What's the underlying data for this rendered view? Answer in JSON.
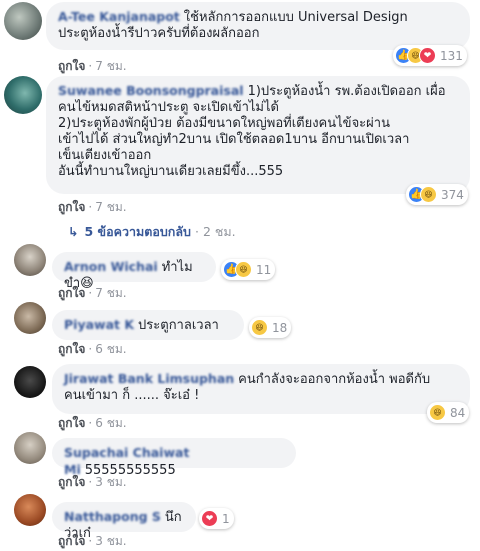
{
  "comments": [
    {
      "author": "A-Tee Kanjanapot",
      "lines": [
        "ใช้หลักการออกแบบ Universal Design",
        "ประตูห้องน้ำรีปาวครับที่ต้องผลักออก"
      ],
      "reactions": [
        "like",
        "haha",
        "love"
      ],
      "reaction_count": "131",
      "like_label": "ถูกใจ",
      "time": "7 ชม."
    },
    {
      "author": "Suwanee Boonsongpraisal",
      "lines": [
        "1)ประตูห้องน้ำ รพ.ต้องเปิดออก เผื่อ",
        "คนไข้หมดสติหน้าประตู จะเปิดเข้าไม่ได้",
        "2)ประตูห้องพักผู้ป่วย ต้องมีขนาดใหญ่พอที่เตียงคนไข้จะผ่าน",
        "เข้าไปได้ ส่วนใหญ่ทำ2บาน เปิดใช้ตลอด1บาน อีกบานเปิดเวลา",
        "เข็นเตียงเข้าออก",
        "อันนี้ทำบานใหญ่บานเดียวเลยมีขึ้ง...555"
      ],
      "reactions": [
        "like",
        "haha"
      ],
      "reaction_count": "374",
      "like_label": "ถูกใจ",
      "time": "7 ชม."
    },
    {
      "author": "Arnon Wichai",
      "lines": [
        "ทำไมขำ😆"
      ],
      "reactions": [
        "like",
        "haha"
      ],
      "reaction_count": "11",
      "like_label": "ถูกใจ",
      "time": "7 ชม."
    },
    {
      "author": "Piyawat K",
      "lines": [
        "ประตูกาลเวลา"
      ],
      "reactions": [
        "haha"
      ],
      "reaction_count": "18",
      "like_label": "ถูกใจ",
      "time": "6 ชม."
    },
    {
      "author": "Jirawat Bank Limsuphan",
      "lines": [
        "คนกำลังจะออกจากห้องน้ำ พอดีกับ",
        "คนเข้ามา ก็ ...... จ๊ะเอ๋ !"
      ],
      "reactions": [
        "haha"
      ],
      "reaction_count": "84",
      "like_label": "ถูกใจ",
      "time": "6 ชม."
    },
    {
      "author": "Supachai Chaiwat Mi",
      "lines": [
        "55555555555"
      ],
      "reactions": [],
      "reaction_count": "",
      "like_label": "ถูกใจ",
      "time": "3 ชม."
    },
    {
      "author": "Natthapong S",
      "lines": [
        "นึกว่าเก๋"
      ],
      "reactions": [
        "love"
      ],
      "reaction_count": "1",
      "like_label": "ถูกใจ",
      "time": "3 ชม."
    }
  ],
  "replies_link": {
    "label": "5 ข้อความตอบกลับ",
    "time": "2 ชม.",
    "separator": "·"
  },
  "separator": "·",
  "reaction_glyphs": {
    "like": "👍",
    "haha": "😆",
    "love": "❤"
  },
  "colors": {
    "link": "#385898",
    "bubble": "#f2f3f5",
    "like": "#3b82f6",
    "haha": "#f7c844",
    "love": "#ec3d55"
  }
}
